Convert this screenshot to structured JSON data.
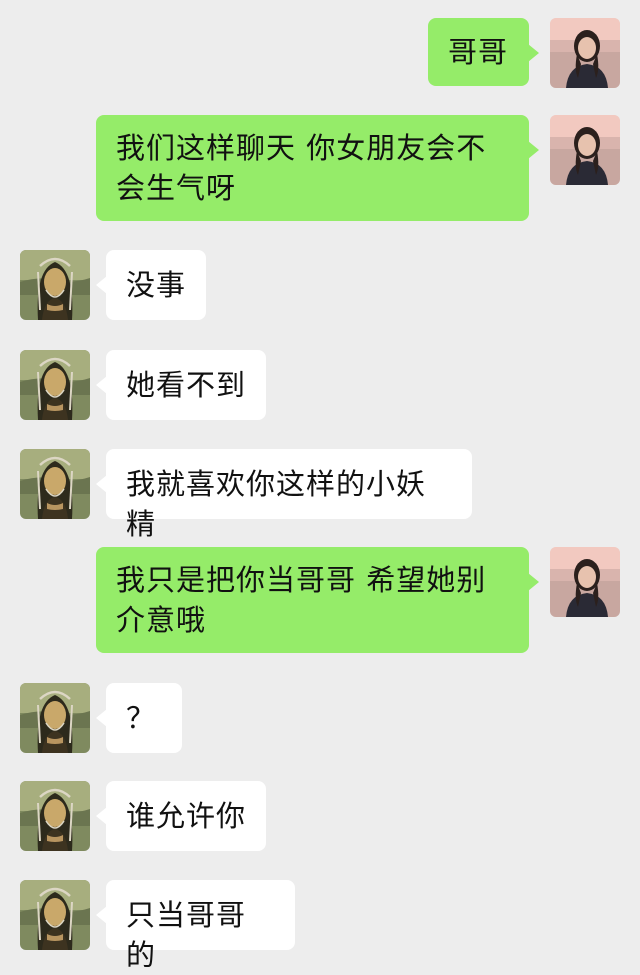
{
  "messages": [
    {
      "sender": "self",
      "text": "哥哥"
    },
    {
      "sender": "self",
      "text": "我们这样聊天 你女朋友会不会生气呀"
    },
    {
      "sender": "other",
      "text": "没事"
    },
    {
      "sender": "other",
      "text": "她看不到"
    },
    {
      "sender": "other",
      "text": "我就喜欢你这样的小妖精"
    },
    {
      "sender": "self",
      "text": "我只是把你当哥哥 希望她别介意哦"
    },
    {
      "sender": "other",
      "text": "？"
    },
    {
      "sender": "other",
      "text": "谁允许你"
    },
    {
      "sender": "other",
      "text": "只当哥哥的"
    }
  ],
  "colors": {
    "background": "#ededed",
    "self_bubble": "#95ec69",
    "other_bubble": "#ffffff"
  },
  "icons": {
    "self_avatar": "girl-photo-avatar",
    "other_avatar": "mona-lisa-avatar"
  }
}
